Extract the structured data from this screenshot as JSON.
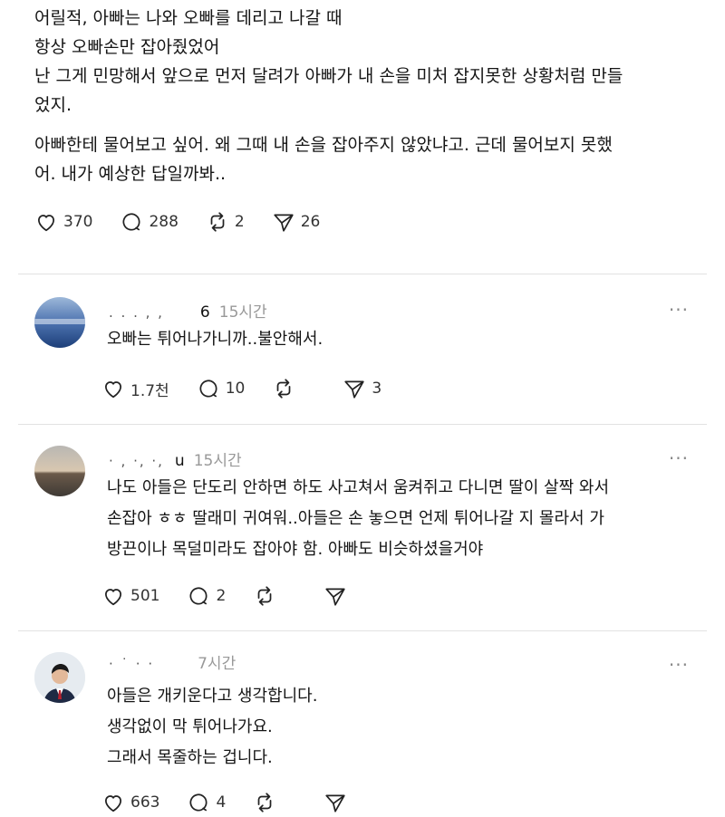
{
  "post": {
    "lines": [
      "어릴적, 아빠는 나와 오빠를 데리고 나갈 때",
      "항상 오빠손만 잡아줬었어",
      "난 그게 민망해서 앞으로 먼저 달려가 아빠가 내 손을 미처 잡지못한 상황처럼 만들",
      "었지.",
      "아빠한테 물어보고 싶어. 왜 그때 내 손을 잡아주지 않았냐고. 근데 물어보지 못했",
      "어. 내가 예상한 답일까봐.."
    ],
    "likes": "370",
    "comments": "288",
    "reposts": "2",
    "shares": "26"
  },
  "replies": [
    {
      "handle_blur": ". . . , ,",
      "handle_end": "6",
      "time": "15시간",
      "more": "···",
      "lines": [
        "오빠는 튀어나가니까..불안해서."
      ],
      "likes": "1.7천",
      "comments": "10",
      "shares": "3"
    },
    {
      "handle_blur": "· ,  ·, ·,",
      "handle_end": "u",
      "time": "15시간",
      "more": "···",
      "lines": [
        "나도 아들은 단도리 안하면 하도 사고쳐서 움켜쥐고 다니면 딸이 살짝 와서",
        "손잡아 ㅎㅎ 딸래미 귀여워..아들은 손 놓으면 언제 튀어나갈 지 몰라서 가",
        "방끈이나 목덜미라도 잡아야 함. 아빠도 비슷하셨을거야"
      ],
      "likes": "501",
      "comments": "2"
    },
    {
      "handle_blur": "· ˙ ·  ·",
      "handle_end": "",
      "time": "7시간",
      "more": "···",
      "lines": [
        "아들은 개키운다고 생각합니다.",
        "생각없이 막 튀어나가요.",
        "그래서 목줄하는 겁니다."
      ],
      "likes": "663",
      "comments": "4"
    }
  ],
  "icons": {
    "like": "heart-icon",
    "comment": "comment-bubble-icon",
    "repost": "repost-icon",
    "share": "send-icon",
    "more": "more-dots-icon"
  },
  "colors": {
    "text": "#151515",
    "muted": "#999999",
    "divider": "#e2e2e2"
  }
}
